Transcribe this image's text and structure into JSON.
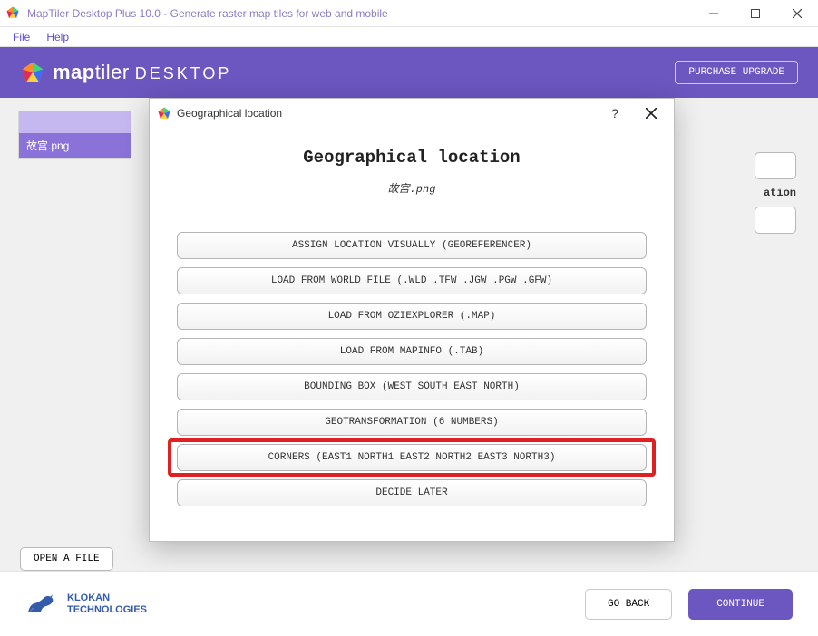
{
  "window": {
    "title": "MapTiler Desktop Plus 10.0 - Generate raster map tiles for web and mobile"
  },
  "menubar": {
    "file": "File",
    "help": "Help"
  },
  "header": {
    "brand_bold": "map",
    "brand_rest": "tiler",
    "brand_suffix": "DESKTOP",
    "purchase": "PURCHASE UPGRADE"
  },
  "sidebar": {
    "items": [
      {
        "label": "故宫.png"
      }
    ]
  },
  "partially_hidden": {
    "text": "ation"
  },
  "open_file": "OPEN A FILE",
  "footer": {
    "brand_line1": "KLOKAN",
    "brand_line2": "TECHNOLOGIES",
    "go_back": "GO BACK",
    "continue": "CONTINUE"
  },
  "dialog": {
    "title": "Geographical location",
    "heading": "Geographical location",
    "filename": "故宫.png",
    "options": [
      "ASSIGN LOCATION VISUALLY (GEOREFERENCER)",
      "LOAD FROM WORLD FILE (.WLD .TFW .JGW .PGW .GFW)",
      "LOAD FROM OZIEXPLORER (.MAP)",
      "LOAD FROM MAPINFO (.TAB)",
      "BOUNDING BOX (WEST SOUTH EAST NORTH)",
      "GEOTRANSFORMATION (6 NUMBERS)",
      "CORNERS (EAST1 NORTH1 EAST2 NORTH2 EAST3 NORTH3)",
      "DECIDE LATER"
    ],
    "highlighted_index": 6
  }
}
